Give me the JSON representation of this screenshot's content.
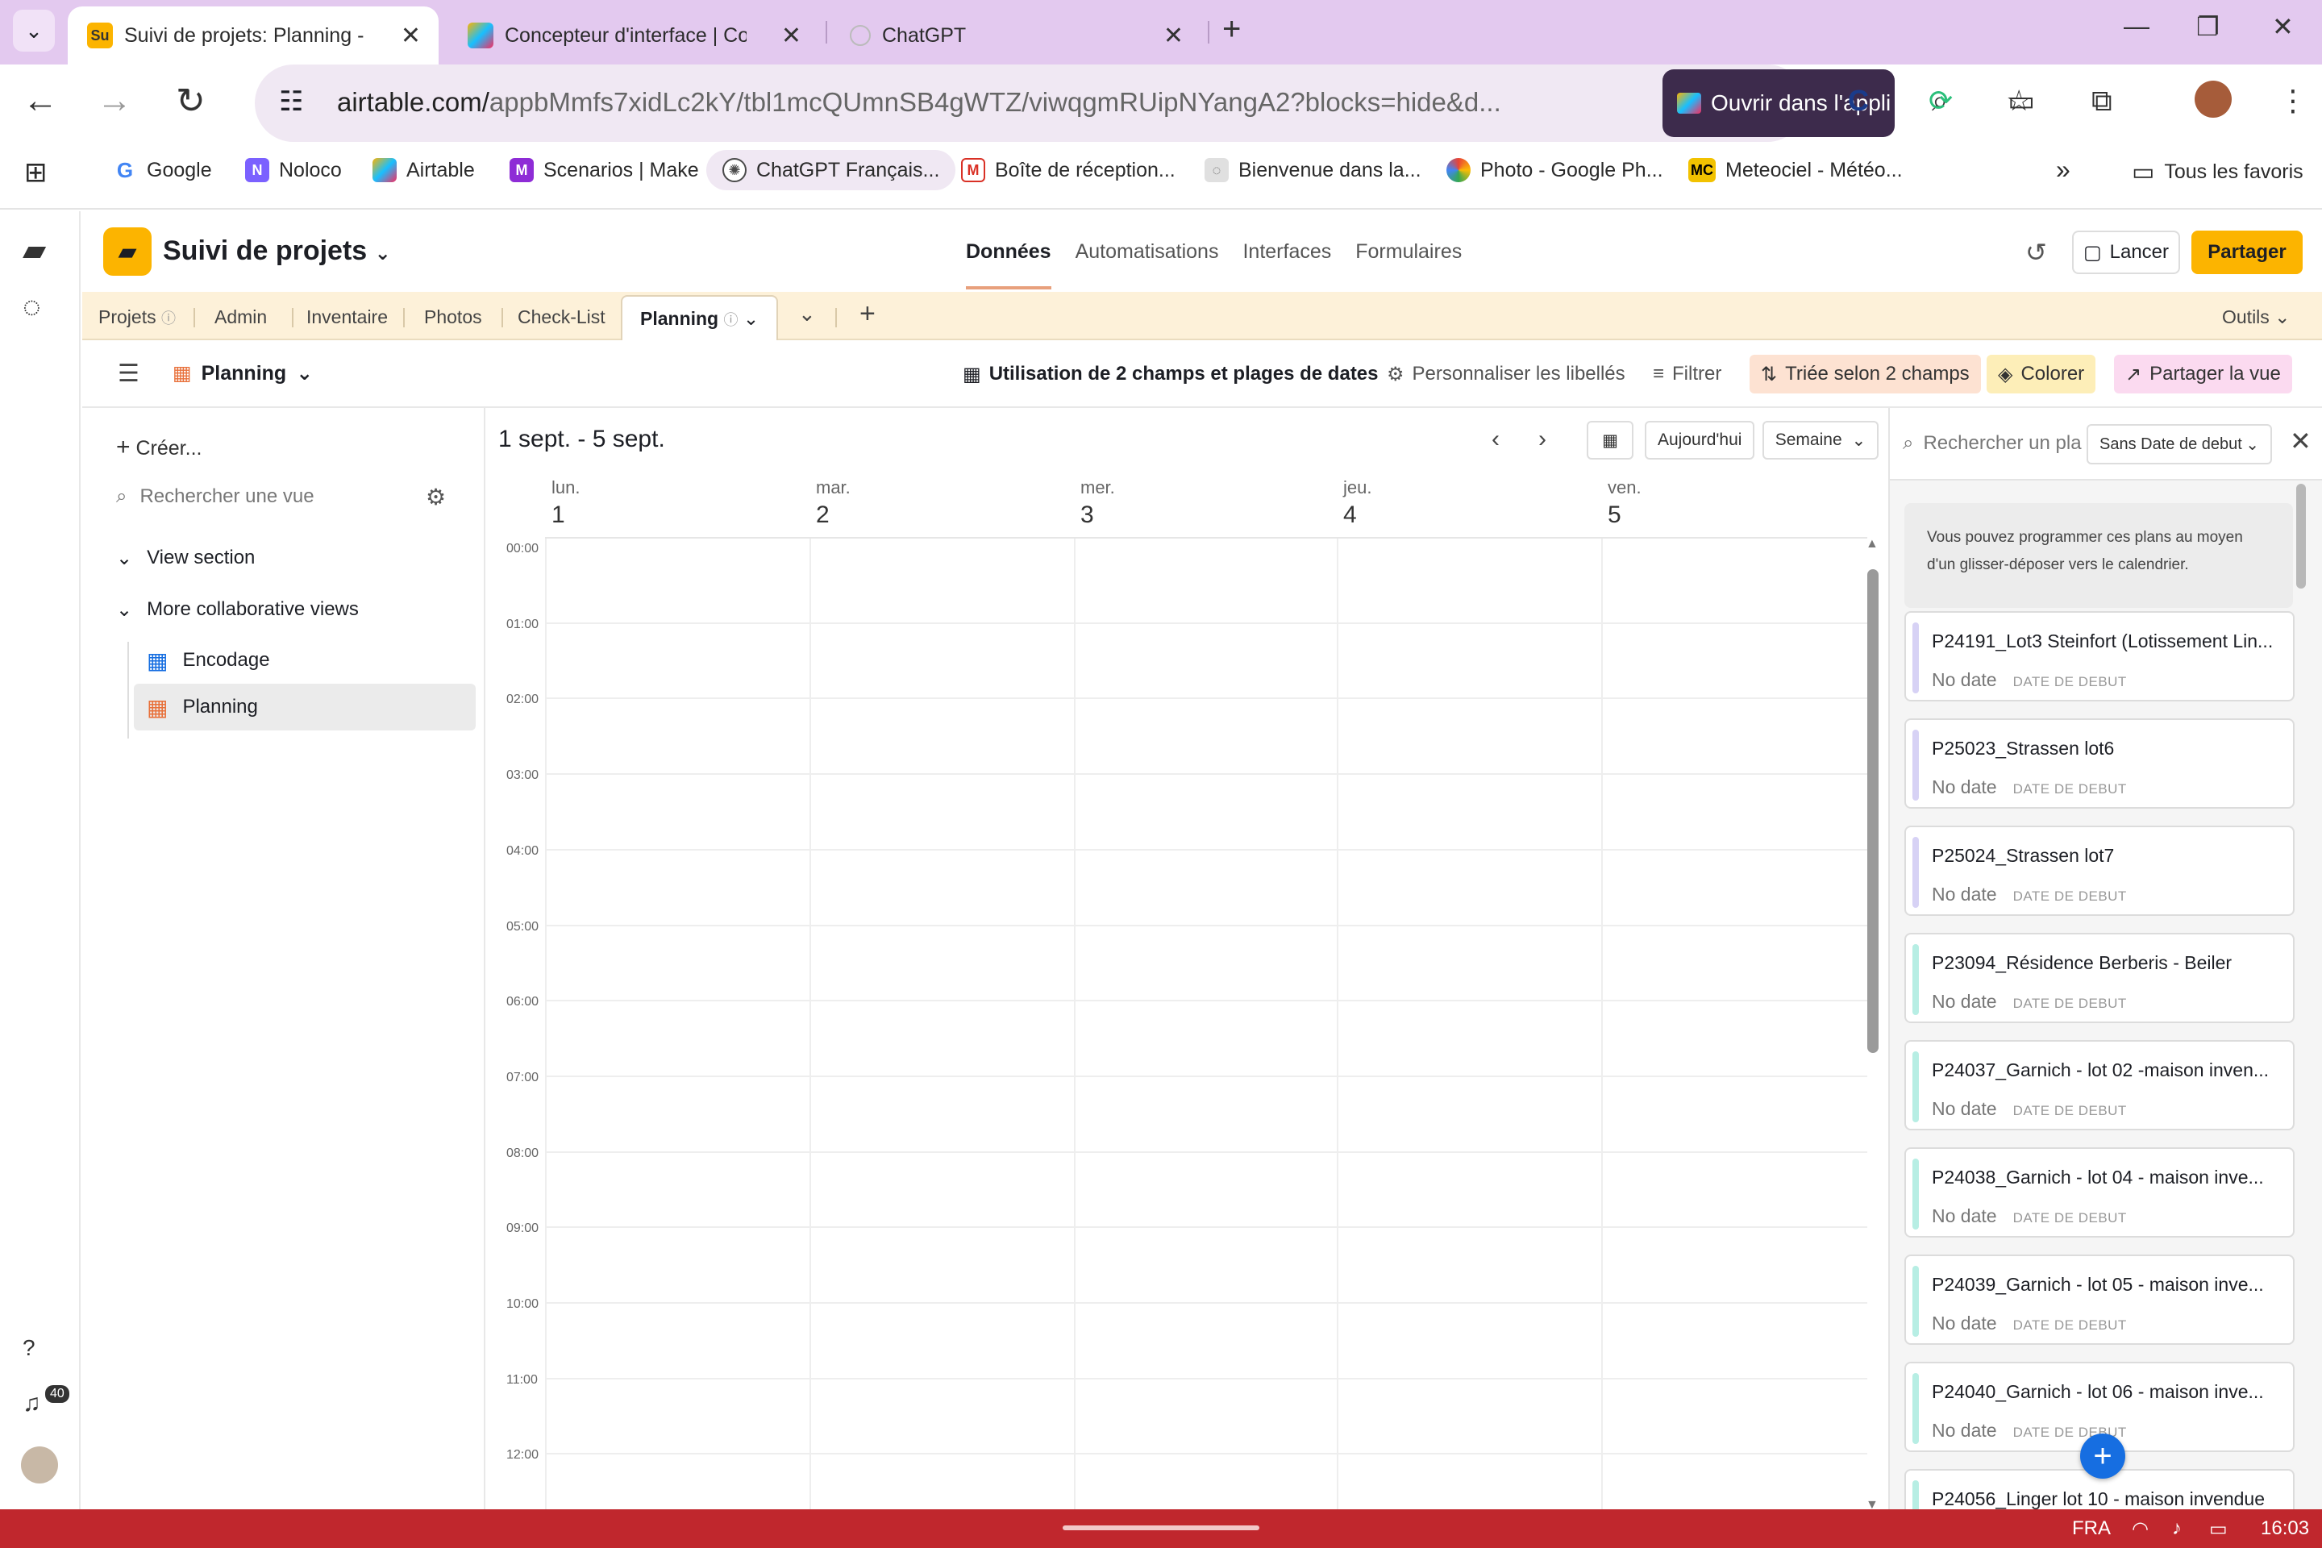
{
  "browser": {
    "tabs": [
      {
        "favicon": "Su",
        "title": "Suivi de projets: Planning - A",
        "active": true
      },
      {
        "favicon": "airtable-logo",
        "title": "Concepteur d'interface | Con",
        "active": false
      },
      {
        "favicon": "chatgpt-logo",
        "title": "ChatGPT",
        "active": false
      }
    ],
    "url_main": "airtable.com/",
    "url_rest": "appbMmfs7xidLc2kY/tbl1mcQUmnSB4gWTZ/viwqgmRUipNYangA2?blocks=hide&d...",
    "open_app_label": "Ouvrir dans l'appli",
    "bookmarks": [
      {
        "label": "Google",
        "color": "#ffffff",
        "icon": "G"
      },
      {
        "label": "Noloco",
        "color": "#7b61ff",
        "icon": "N"
      },
      {
        "label": "Airtable",
        "color": "#fcb400",
        "icon": "A"
      },
      {
        "label": "Scenarios | Make",
        "color": "#8e2cd6",
        "icon": "M"
      },
      {
        "label": "ChatGPT Français...",
        "color": "#4a4a4a",
        "icon": "C"
      },
      {
        "label": "Boîte de réception...",
        "color": "#d93025",
        "icon": "M"
      },
      {
        "label": "Bienvenue dans la...",
        "color": "#999999",
        "icon": "B"
      },
      {
        "label": "Photo - Google Ph...",
        "color": "#34a853",
        "icon": "P"
      },
      {
        "label": "Meteociel - Météo...",
        "color": "#f2c200",
        "icon": "MC"
      }
    ],
    "all_bookmarks_label": "Tous les favoris"
  },
  "base": {
    "name": "Suivi de projets",
    "nav_tabs": [
      "Données",
      "Automatisations",
      "Interfaces",
      "Formulaires"
    ],
    "launch_label": "Lancer",
    "share_label": "Partager",
    "tables": [
      "Projets",
      "Admin",
      "Inventaire",
      "Photos",
      "Check-List",
      "Planning"
    ],
    "tools_label": "Outils"
  },
  "viewbar": {
    "view_name": "Planning",
    "date_fields": "Utilisation de 2 champs et plages de dates",
    "customize_labels": "Personnaliser les libellés",
    "filter": "Filtrer",
    "sort": "Triée selon 2 champs",
    "color": "Colorer",
    "share_view": "Partager la vue"
  },
  "sidebar": {
    "create": "Créer...",
    "search_placeholder": "Rechercher une vue",
    "section1": "View section",
    "section2": "More collaborative views",
    "views": [
      {
        "name": "Encodage",
        "icon": "grid-icon"
      },
      {
        "name": "Planning",
        "icon": "calendar-icon",
        "selected": true
      }
    ]
  },
  "calendar": {
    "range": "1 sept. - 5 sept.",
    "today_label": "Aujourd'hui",
    "mode_label": "Semaine",
    "days": [
      {
        "name": "lun.",
        "num": "1"
      },
      {
        "name": "mar.",
        "num": "2"
      },
      {
        "name": "mer.",
        "num": "3"
      },
      {
        "name": "jeu.",
        "num": "4"
      },
      {
        "name": "ven.",
        "num": "5"
      }
    ],
    "hours": [
      "00:00",
      "01:00",
      "02:00",
      "03:00",
      "04:00",
      "05:00",
      "06:00",
      "07:00",
      "08:00",
      "09:00",
      "10:00",
      "11:00",
      "12:00"
    ]
  },
  "panel": {
    "search_placeholder": "Rechercher un pla",
    "filter_select": "Sans Date de debut",
    "info": "Vous pouvez programmer ces plans au moyen d'un glisser-déposer vers le calendrier.",
    "no_date": "No date",
    "date_label": "DATE DE DEBUT",
    "cards": [
      {
        "title": "P24191_Lot3 Steinfort (Lotissement Lin...",
        "color": "#d7d2f5"
      },
      {
        "title": "P25023_Strassen lot6",
        "color": "#d7d2f5"
      },
      {
        "title": "P25024_Strassen lot7",
        "color": "#d7d2f5"
      },
      {
        "title": "P23094_Résidence Berberis - Beiler",
        "color": "#b7eee4"
      },
      {
        "title": "P24037_Garnich - lot 02 -maison inven...",
        "color": "#b7eee4"
      },
      {
        "title": "P24038_Garnich - lot 04 - maison inve...",
        "color": "#b7eee4"
      },
      {
        "title": "P24039_Garnich - lot 05 - maison inve...",
        "color": "#b7eee4"
      },
      {
        "title": "P24040_Garnich - lot 06 - maison inve...",
        "color": "#b7eee4"
      },
      {
        "title": "P24056_Linger lot 10 - maison invendue",
        "color": "#b7eee4"
      }
    ]
  },
  "rail": {
    "notification_count": "40"
  },
  "taskbar": {
    "lang": "FRA",
    "time": "16:03"
  }
}
